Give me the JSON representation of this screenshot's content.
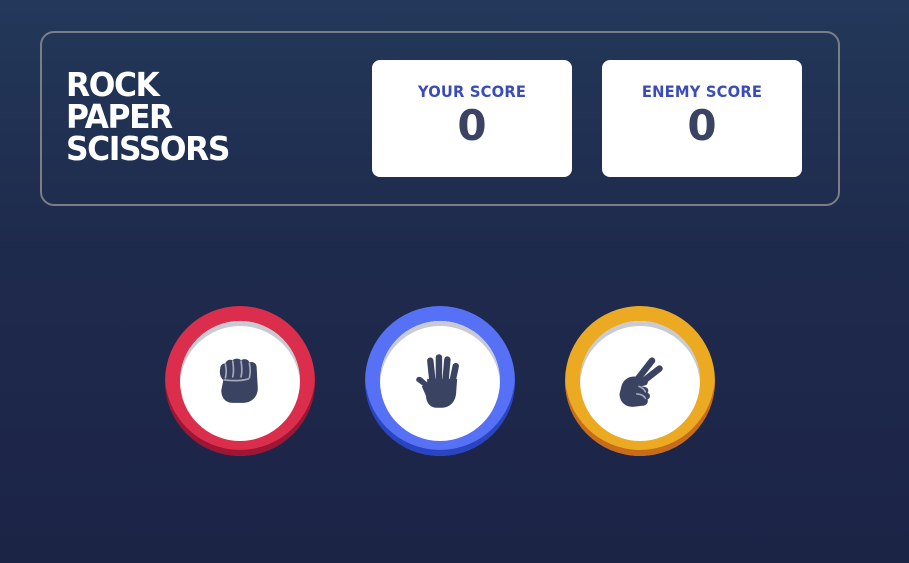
{
  "title": {
    "line1": "ROCK",
    "line2": "PAPER",
    "line3": "SCISSORS"
  },
  "scores": {
    "player_label": "YOUR SCORE",
    "player_value": "0",
    "enemy_label": "ENEMY SCORE",
    "enemy_value": "0"
  },
  "choices": [
    {
      "name": "rock",
      "icon": "fist-icon",
      "color": "#db2e4d"
    },
    {
      "name": "paper",
      "icon": "open-hand-icon",
      "color": "#5671f5"
    },
    {
      "name": "scissors",
      "icon": "peace-hand-icon",
      "color": "#eca922"
    }
  ],
  "colors": {
    "background_top": "#23385a",
    "background_bottom": "#1c2446",
    "score_label": "#3b4cb8",
    "score_value": "#3b4363",
    "icon_fill": "#3b4363",
    "header_border": "#7a7e86"
  }
}
